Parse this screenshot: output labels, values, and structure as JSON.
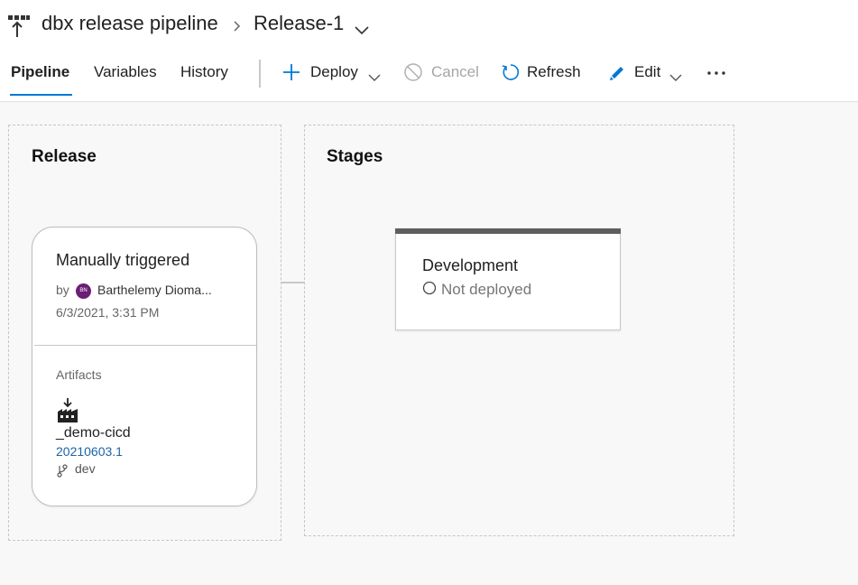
{
  "header": {
    "pipeline_name": "dbx release pipeline",
    "release_name": "Release-1",
    "icons": {
      "pipeline": "release-pipeline-icon",
      "separator": "chevron-right-icon",
      "release_menu": "chevron-down-icon"
    }
  },
  "tabs": [
    {
      "label": "Pipeline",
      "active": true
    },
    {
      "label": "Variables",
      "active": false
    },
    {
      "label": "History",
      "active": false
    }
  ],
  "commands": {
    "deploy": {
      "label": "Deploy",
      "icon": "plus-icon"
    },
    "cancel": {
      "label": "Cancel",
      "icon": "cancel-icon",
      "disabled": true
    },
    "refresh": {
      "label": "Refresh",
      "icon": "refresh-icon"
    },
    "edit": {
      "label": "Edit",
      "icon": "pencil-icon"
    },
    "more_icon": "more-icon"
  },
  "release_panel": {
    "title": "Release",
    "card": {
      "trigger": "Manually triggered",
      "by_label": "by",
      "avatar_initials": "BN",
      "user": "Barthelemy Dioma...",
      "timestamp": "6/3/2021, 3:31 PM",
      "artifacts_label": "Artifacts",
      "artifact": {
        "icon": "build-artifact-icon",
        "name": "_demo-cicd",
        "version": "20210603.1",
        "branch_icon": "branch-icon",
        "branch": "dev"
      }
    }
  },
  "stages_panel": {
    "title": "Stages",
    "stages": [
      {
        "name": "Development",
        "status": "Not deployed",
        "status_icon": "circle-outline-icon"
      }
    ]
  },
  "colors": {
    "accent": "#0078d4",
    "link": "#1c64a8",
    "avatar": "#6b1e73",
    "stage_bar": "#605e5c",
    "disabled": "#a6a6a6"
  }
}
